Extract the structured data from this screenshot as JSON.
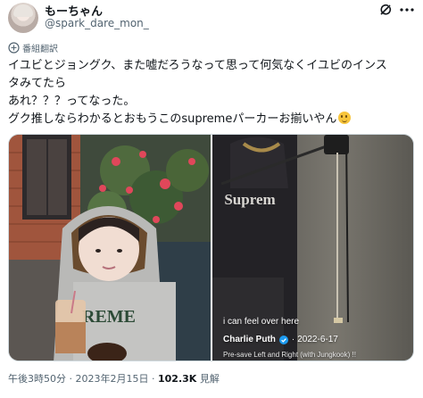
{
  "author": {
    "display_name": "もーちゃん",
    "handle": "@spark_dare_mon_"
  },
  "translate": {
    "label": "番組翻訳"
  },
  "tweet": {
    "lines": [
      "イユビとジョングク、また嘘だろうなって思って何気なくイユビのインス",
      "タみてたら",
      "あれ？？？ってなった。",
      "グク推しならわかるとおもうこのsupremeパーカーお揃いやん"
    ],
    "emoji": "smiling-face-emoji"
  },
  "media": {
    "left_photo": {
      "hoodie_text": "REME"
    },
    "right_photo": {
      "hoodie_text": "Suprem",
      "caption": "i can feel over here",
      "artist": "Charlie Puth",
      "date": "2022-6-17",
      "song": "Pre-save Left and Right (with Jungkook) !!"
    }
  },
  "footer": {
    "time": "午後3時50分",
    "date": "2023年2月15日",
    "views_count": "102.3K",
    "views_label": "見解",
    "separator": "·"
  },
  "icons": {
    "avatar": "avatar",
    "grok": "grok-icon",
    "more": "more-icon",
    "translate": "translate-icon",
    "verified": "verified-badge-icon"
  },
  "colors": {
    "text": "#0f1419",
    "secondary": "#536471",
    "verified": "#1d9bf0"
  }
}
